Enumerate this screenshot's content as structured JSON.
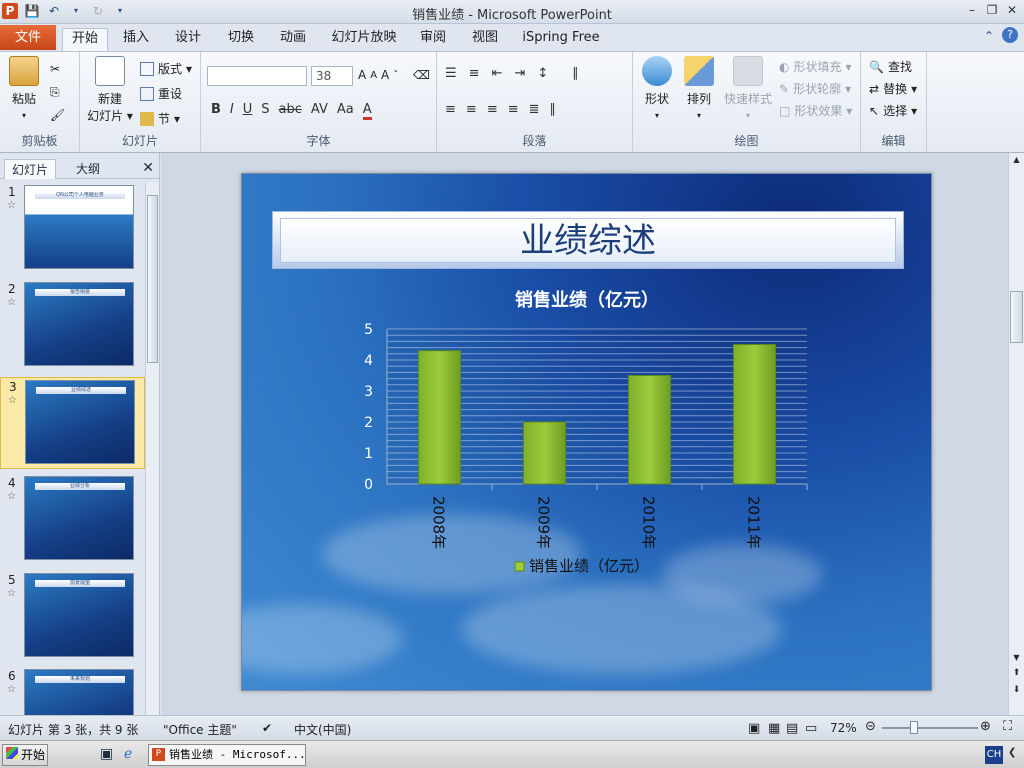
{
  "window": {
    "title": "销售业绩 - Microsoft PowerPoint",
    "app_icon": "P"
  },
  "tabs": [
    {
      "label": "文件"
    },
    {
      "label": "开始"
    },
    {
      "label": "插入"
    },
    {
      "label": "设计"
    },
    {
      "label": "切换"
    },
    {
      "label": "动画"
    },
    {
      "label": "幻灯片放映"
    },
    {
      "label": "审阅"
    },
    {
      "label": "视图"
    },
    {
      "label": "iSpring Free"
    }
  ],
  "ribbon": {
    "clipboard": {
      "label": "剪贴板",
      "paste": "粘贴"
    },
    "slides": {
      "label": "幻灯片",
      "new_slide_1": "新建",
      "new_slide_2": "幻灯片",
      "layout": "版式",
      "reset": "重设",
      "section": "节"
    },
    "font": {
      "label": "字体",
      "font_name": "",
      "font_size": "38",
      "bold": "B",
      "italic": "I",
      "underline": "U",
      "shadow": "S",
      "strike": "abc",
      "spacing": "AV",
      "case": "Aa",
      "color": "A"
    },
    "paragraph": {
      "label": "段落"
    },
    "drawing": {
      "label": "绘图",
      "shapes": "形状",
      "arrange": "排列",
      "quick_styles": "快速样式",
      "shape_fill": "形状填充",
      "shape_outline": "形状轮廓",
      "shape_effects": "形状效果"
    },
    "editing": {
      "label": "编辑",
      "find": "查找",
      "replace": "替换",
      "select": "选择"
    }
  },
  "pane": {
    "tab_slides": "幻灯片",
    "tab_outline": "大纲",
    "thumbs": [
      {
        "num": "1",
        "title": "QN公司个人电脑业务",
        "sub": "——销售业绩报告"
      },
      {
        "num": "2",
        "title": "报告纲要"
      },
      {
        "num": "3",
        "title": "业绩综述"
      },
      {
        "num": "4",
        "title": "业绩分析"
      },
      {
        "num": "5",
        "title": "前景展望"
      },
      {
        "num": "6",
        "title": "未来规划"
      }
    ]
  },
  "slide": {
    "title": "业绩综述"
  },
  "chart_data": {
    "type": "bar",
    "title": "销售业绩（亿元）",
    "categories": [
      "2008年",
      "2009年",
      "2010年",
      "2011年"
    ],
    "series": [
      {
        "name": "销售业绩（亿元）",
        "values": [
          4.3,
          2.0,
          3.5,
          4.5
        ]
      }
    ],
    "ylim": [
      0,
      5
    ],
    "yticks": [
      "0",
      "1",
      "2",
      "3",
      "4",
      "5"
    ],
    "grid": true,
    "legend": "bottom",
    "bar_color": "#9ccc3c"
  },
  "status": {
    "slide_info": "幻灯片 第 3 张，共 9 张",
    "theme": "\"Office 主题\"",
    "language": "中文(中国)",
    "zoom": "72%"
  },
  "taskbar": {
    "start": "开始",
    "task": "销售业绩 - Microsof...",
    "ime": "CH"
  }
}
